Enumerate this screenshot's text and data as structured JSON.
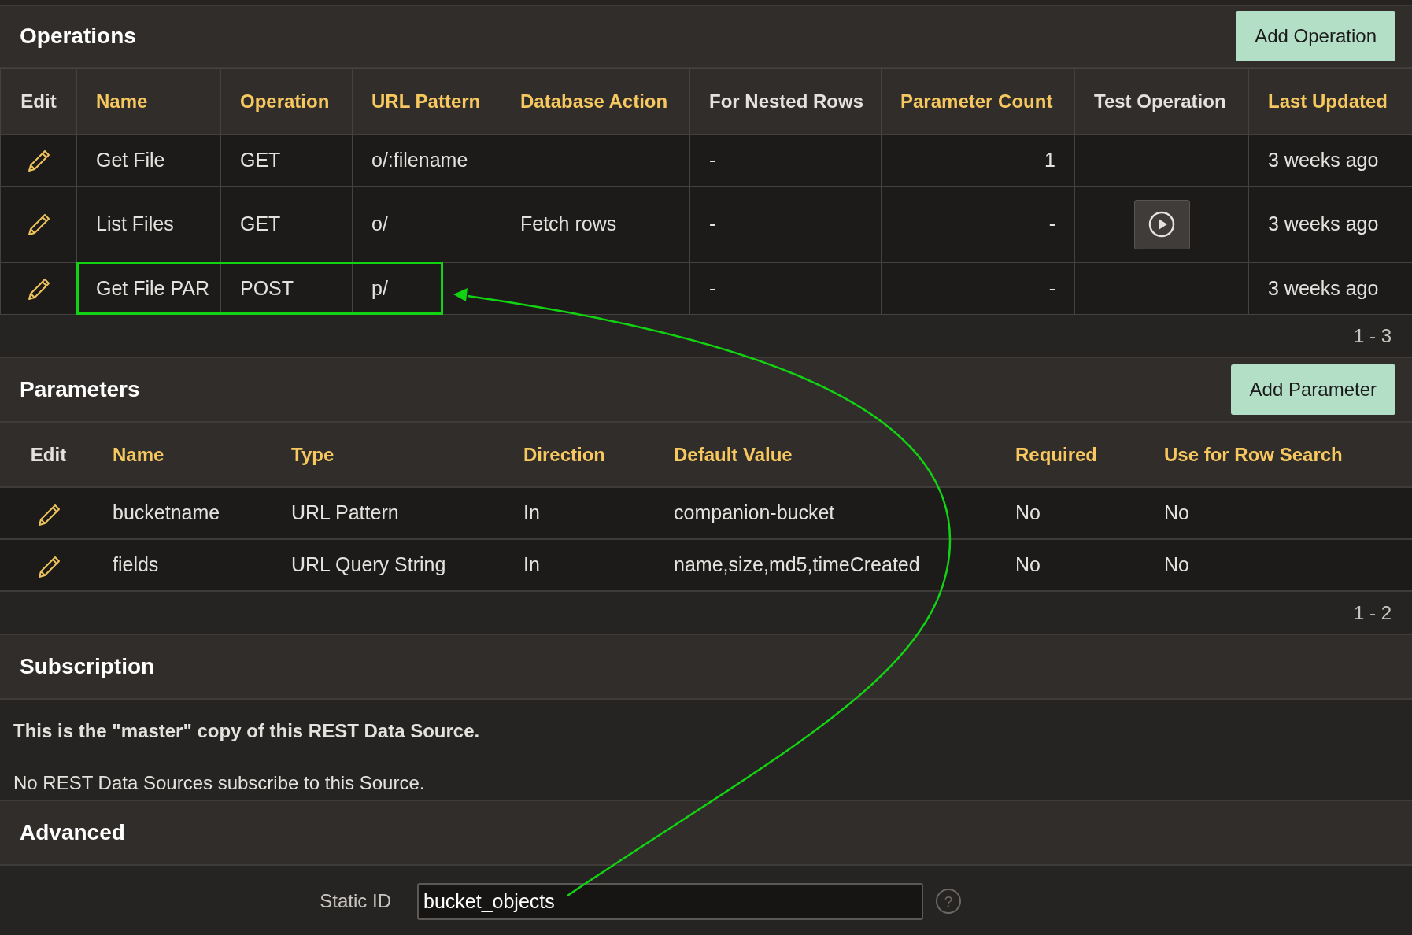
{
  "operations": {
    "title": "Operations",
    "add_button": "Add Operation",
    "columns": [
      {
        "label": "Edit",
        "sortable": false
      },
      {
        "label": "Name",
        "sortable": true
      },
      {
        "label": "Operation",
        "sortable": true
      },
      {
        "label": "URL Pattern",
        "sortable": true
      },
      {
        "label": "Database Action",
        "sortable": true
      },
      {
        "label": "For Nested Rows",
        "sortable": false
      },
      {
        "label": "Parameter Count",
        "sortable": true
      },
      {
        "label": "Test Operation",
        "sortable": false
      },
      {
        "label": "Last Updated",
        "sortable": true
      }
    ],
    "rows": [
      {
        "name": "Get File",
        "operation": "GET",
        "url_pattern": "o/:filename",
        "database_action": "",
        "for_nested_rows": "-",
        "parameter_count": "1",
        "test_button": false,
        "last_updated": "3 weeks ago",
        "annotated": false
      },
      {
        "name": "List Files",
        "operation": "GET",
        "url_pattern": "o/",
        "database_action": "Fetch rows",
        "for_nested_rows": "-",
        "parameter_count": "-",
        "test_button": true,
        "last_updated": "3 weeks ago",
        "annotated": false
      },
      {
        "name": "Get File PAR",
        "operation": "POST",
        "url_pattern": "p/",
        "database_action": "",
        "for_nested_rows": "-",
        "parameter_count": "-",
        "test_button": false,
        "last_updated": "3 weeks ago",
        "annotated": true
      }
    ],
    "pagination": "1 - 3"
  },
  "parameters": {
    "title": "Parameters",
    "add_button": "Add Parameter",
    "columns": [
      {
        "label": "Edit",
        "sortable": false
      },
      {
        "label": "Name",
        "sortable": true
      },
      {
        "label": "Type",
        "sortable": true
      },
      {
        "label": "Direction",
        "sortable": true
      },
      {
        "label": "Default Value",
        "sortable": true
      },
      {
        "label": "Required",
        "sortable": true
      },
      {
        "label": "Use for Row Search",
        "sortable": true
      }
    ],
    "rows": [
      {
        "name": "bucketname",
        "type": "URL Pattern",
        "direction": "In",
        "default_value": "companion-bucket",
        "required": "No",
        "use_for_row_search": "No"
      },
      {
        "name": "fields",
        "type": "URL Query String",
        "direction": "In",
        "default_value": "name,size,md5,timeCreated",
        "required": "No",
        "use_for_row_search": "No"
      }
    ],
    "pagination": "1 - 2"
  },
  "subscription": {
    "title": "Subscription",
    "note": "This is the \"master\" copy of this REST Data Source.",
    "text": "No REST Data Sources subscribe to this Source."
  },
  "advanced": {
    "title": "Advanced",
    "static_id": {
      "label": "Static ID",
      "value": "bucket_objects",
      "annotated": true,
      "help": "?"
    }
  }
}
